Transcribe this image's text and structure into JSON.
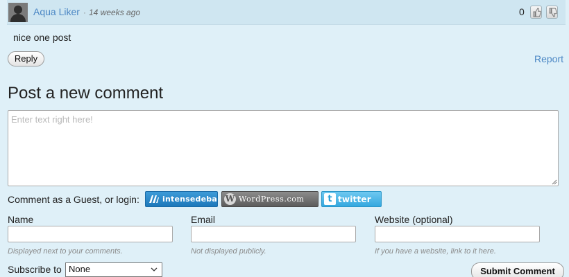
{
  "comment": {
    "author": "Aqua Liker",
    "separator": "·",
    "time": "14 weeks ago",
    "vote_count": "0",
    "text": "nice one post",
    "reply_label": "Reply",
    "report_label": "Report"
  },
  "new_comment": {
    "heading": "Post a new comment",
    "placeholder": "Enter text right here!"
  },
  "login": {
    "label": "Comment as a Guest, or login:",
    "intensedebate": "intensedebate",
    "wordpress": "WordPress.com",
    "twitter": "twitter"
  },
  "fields": {
    "name_label": "Name",
    "name_hint": "Displayed next to your comments.",
    "email_label": "Email",
    "email_hint": "Not displayed publicly.",
    "website_label": "Website (optional)",
    "website_hint": "If you have a website, link to it here."
  },
  "subscribe": {
    "label": "Subscribe to",
    "selected": "None"
  },
  "submit_label": "Submit Comment",
  "colors": {
    "background": "#dff0f8",
    "link": "#4a86c4",
    "intensedebate": "#1d78ba",
    "twitter": "#34a8df",
    "wordpress": "#5c5c5c"
  },
  "icons": [
    "avatar-icon",
    "thumbs-up-icon",
    "thumbs-down-icon",
    "intensedebate-logo-icon",
    "wordpress-logo-icon",
    "twitter-logo-icon",
    "chevron-down-icon",
    "resize-grip-icon"
  ]
}
